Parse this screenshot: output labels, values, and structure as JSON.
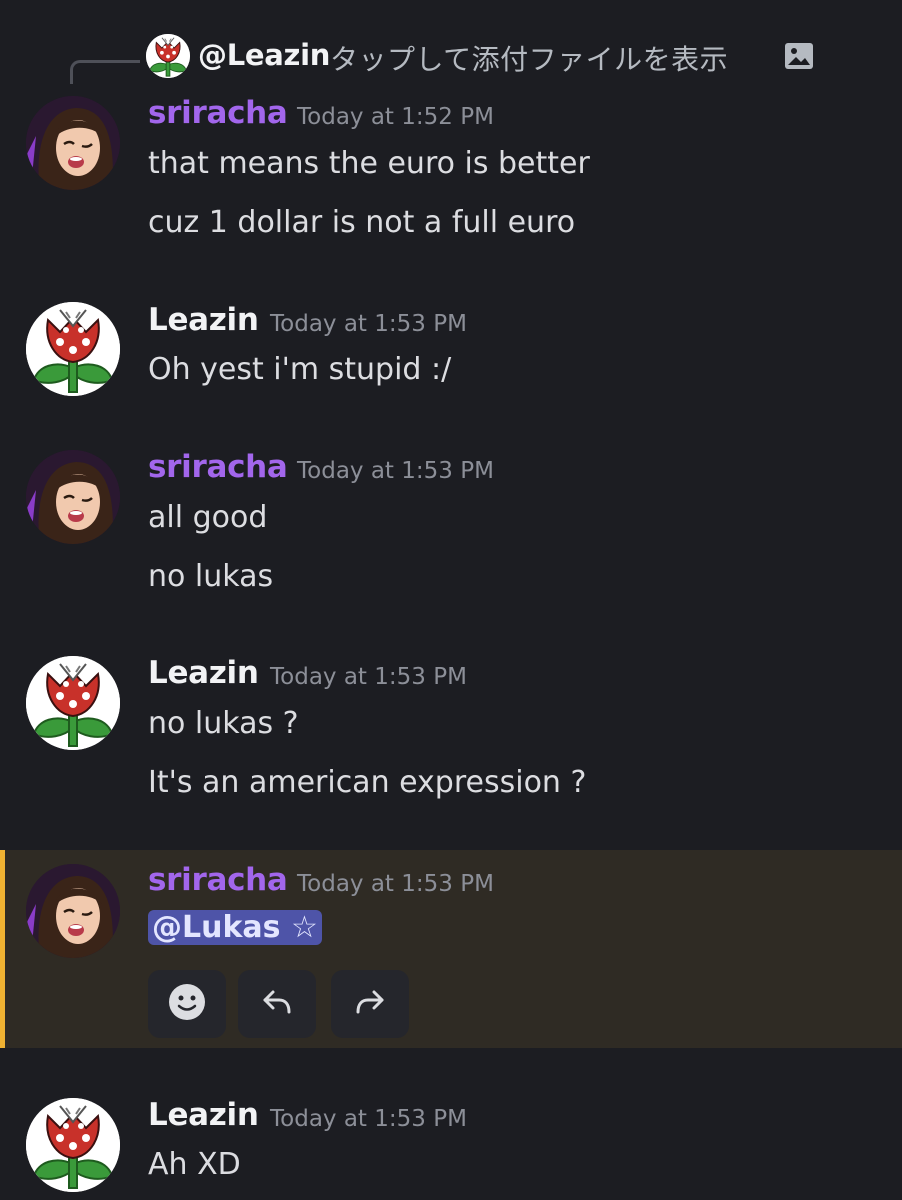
{
  "reply_preview": {
    "author": "@Leazin",
    "text": "タップして添付ファイルを表示",
    "icon": "image-icon"
  },
  "messages": [
    {
      "author": "sriracha",
      "timestamp": "Today at 1:52 PM",
      "lines": [
        "that means the euro is better",
        "cuz 1 dollar is not a full euro"
      ]
    },
    {
      "author": "Leazin",
      "timestamp": "Today at 1:53 PM",
      "lines": [
        "Oh yest i'm stupid :/"
      ]
    },
    {
      "author": "sriracha",
      "timestamp": "Today at 1:53 PM",
      "lines": [
        "all good",
        "no lukas"
      ]
    },
    {
      "author": "Leazin",
      "timestamp": "Today at 1:53 PM",
      "lines": [
        "no lukas ?",
        "It's an american expression ?"
      ]
    },
    {
      "author": "sriracha",
      "timestamp": "Today at 1:53 PM",
      "mention": "@Lukas ☆",
      "highlighted": true
    },
    {
      "author": "Leazin",
      "timestamp": "Today at 1:53 PM",
      "lines": [
        "Ah XD"
      ]
    }
  ],
  "actions": {
    "icons": [
      "emoji-reaction-icon",
      "reply-icon",
      "forward-icon"
    ]
  },
  "colors": {
    "background": "#1c1d22",
    "sriracha_name": "#a266ec",
    "highlight_bg": "#2f2b24",
    "highlight_bar": "#f0b232",
    "mention_bg": "#4e54a8"
  }
}
